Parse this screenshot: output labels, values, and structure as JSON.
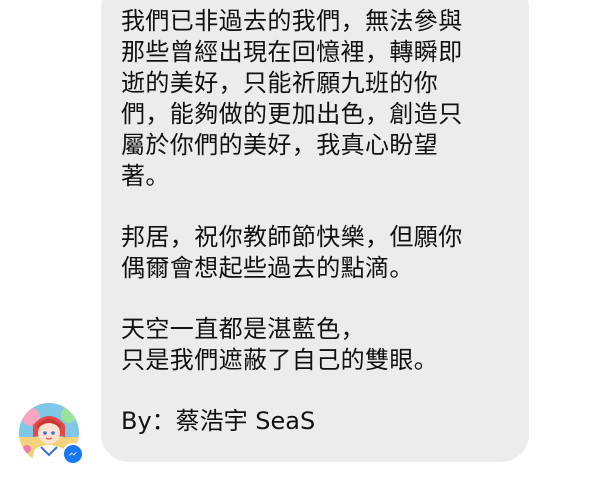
{
  "message": {
    "paragraphs": [
      [
        "我們已非過去的我們，無法參與",
        "那些曾經出現在回憶裡，轉瞬即",
        "逝的美好，只能祈願九班的你",
        "們，能夠做的更加出色，創造只",
        "屬於你們的美好，我真心盼望",
        "著。"
      ],
      [
        "邦居，祝你教師節快樂，但願你",
        "偶爾會想起些過去的點滴。"
      ],
      [
        "天空一直都是湛藍色，",
        "只是我們遮蔽了自己的雙眼。"
      ]
    ],
    "signature": "By：蔡浩宇 SeaS"
  },
  "sender": {
    "avatar_icon": "anime-character-avatar-icon",
    "badge_icon": "messenger-icon",
    "badge_color": "#1877f2"
  },
  "colors": {
    "bubble_background": "#ececec",
    "text": "#111111",
    "page_background": "#ffffff"
  }
}
